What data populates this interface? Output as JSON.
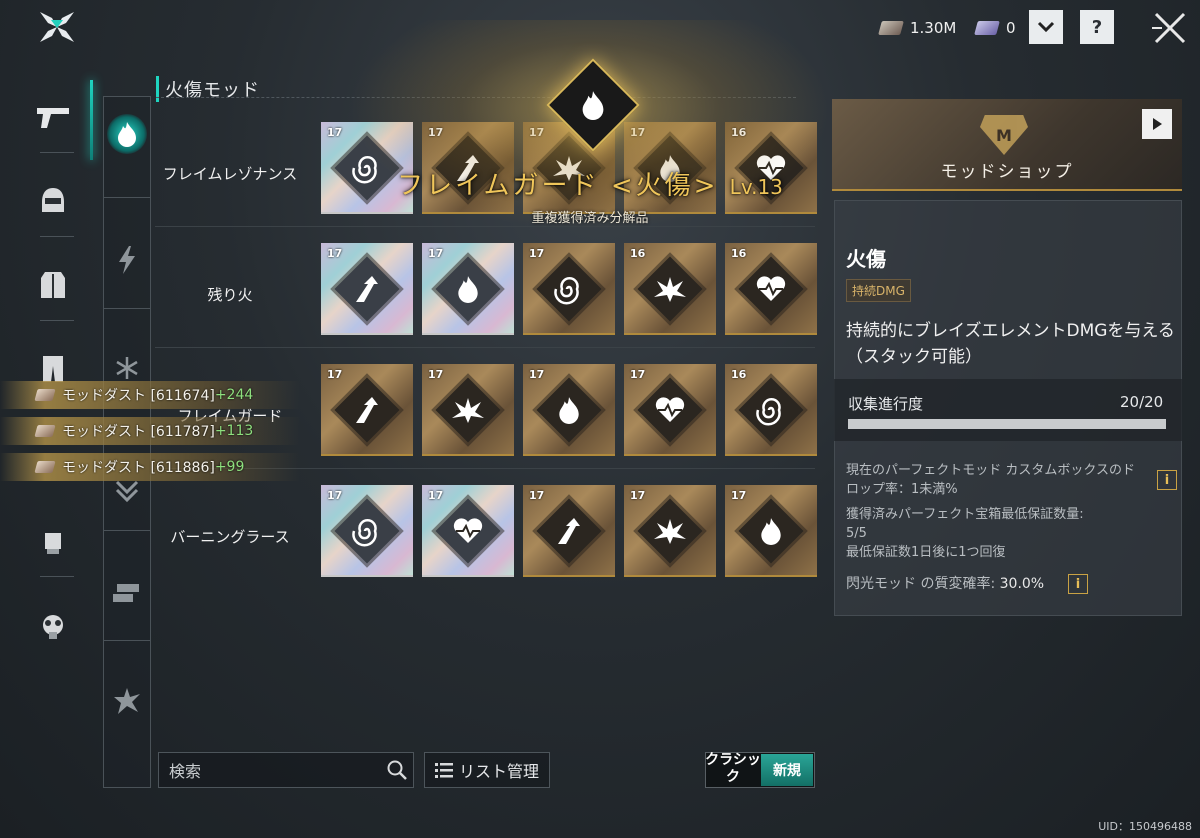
{
  "topbar": {
    "currency_1": "1.30M",
    "currency_2": "0",
    "dropdown_icon": "chevron-down-icon",
    "help_label": "?",
    "close_icon": "close-icon"
  },
  "section_title": "火傷モッド",
  "rows": [
    {
      "label": "フレイムレゾナンス",
      "cards": [
        {
          "level": "17",
          "style": "holo",
          "icon": "spiral"
        },
        {
          "level": "17",
          "style": "gold",
          "icon": "arrow-up"
        },
        {
          "level": "17",
          "style": "gold",
          "icon": "burst"
        },
        {
          "level": "17",
          "style": "gold",
          "icon": "flame"
        },
        {
          "level": "16",
          "style": "gold",
          "icon": "heart"
        }
      ]
    },
    {
      "label": "残り火",
      "cards": [
        {
          "level": "17",
          "style": "holo",
          "icon": "arrow-up"
        },
        {
          "level": "17",
          "style": "holo",
          "icon": "flame"
        },
        {
          "level": "17",
          "style": "gold",
          "icon": "spiral"
        },
        {
          "level": "16",
          "style": "gold",
          "icon": "burst"
        },
        {
          "level": "16",
          "style": "gold",
          "icon": "heart"
        }
      ]
    },
    {
      "label": "フレイムガード",
      "cards": [
        {
          "level": "17",
          "style": "gold",
          "icon": "arrow-up"
        },
        {
          "level": "17",
          "style": "gold",
          "icon": "burst"
        },
        {
          "level": "17",
          "style": "gold",
          "icon": "flame"
        },
        {
          "level": "17",
          "style": "gold",
          "icon": "heart"
        },
        {
          "level": "16",
          "style": "gold",
          "icon": "spiral"
        }
      ]
    },
    {
      "label": "バーニングラース",
      "cards": [
        {
          "level": "17",
          "style": "holo",
          "icon": "spiral"
        },
        {
          "level": "17",
          "style": "holo",
          "icon": "heart"
        },
        {
          "level": "17",
          "style": "gold",
          "icon": "arrow-up"
        },
        {
          "level": "17",
          "style": "gold",
          "icon": "burst"
        },
        {
          "level": "17",
          "style": "gold",
          "icon": "flame"
        }
      ]
    }
  ],
  "popup": {
    "title": "フレイムガード <火傷>",
    "level": "Lv.13",
    "subtitle": "重複獲得済み分解品"
  },
  "notifications": [
    {
      "text": "モッドダスト [611674]",
      "plus": "+244"
    },
    {
      "text": "モッドダスト [611787]",
      "plus": "+113"
    },
    {
      "text": "モッドダスト [611886]",
      "plus": "+99"
    }
  ],
  "shop": {
    "label": "モッドショップ",
    "emblem": "M"
  },
  "detail": {
    "name": "火傷",
    "tag": "持続DMG",
    "description": "持続的にブレイズエレメントDMGを与える（スタック可能）",
    "progress_label": "収集進行度",
    "progress_value": "20/20",
    "progress_fraction": 1.0,
    "info_1": "現在のパーフェクトモッド カスタムボックスのドロップ率：1未満%",
    "info_2": "獲得済みパーフェクト宝箱最低保証数量:",
    "info_3": "5/5",
    "info_4": "最低保証数1日後に1つ回復",
    "info_5_label": "閃光モッド の質変確率: ",
    "info_5_value": "30.0%",
    "info_button": "i"
  },
  "bottom": {
    "search_placeholder": "検索",
    "list_button": "リスト管理",
    "toggle_classic": "クラシック",
    "toggle_new": "新規"
  },
  "uid": "UID：150496488",
  "colors": {
    "accent": "#1fd4c0",
    "gold": "#d8b85a",
    "green": "#8ee07e"
  }
}
